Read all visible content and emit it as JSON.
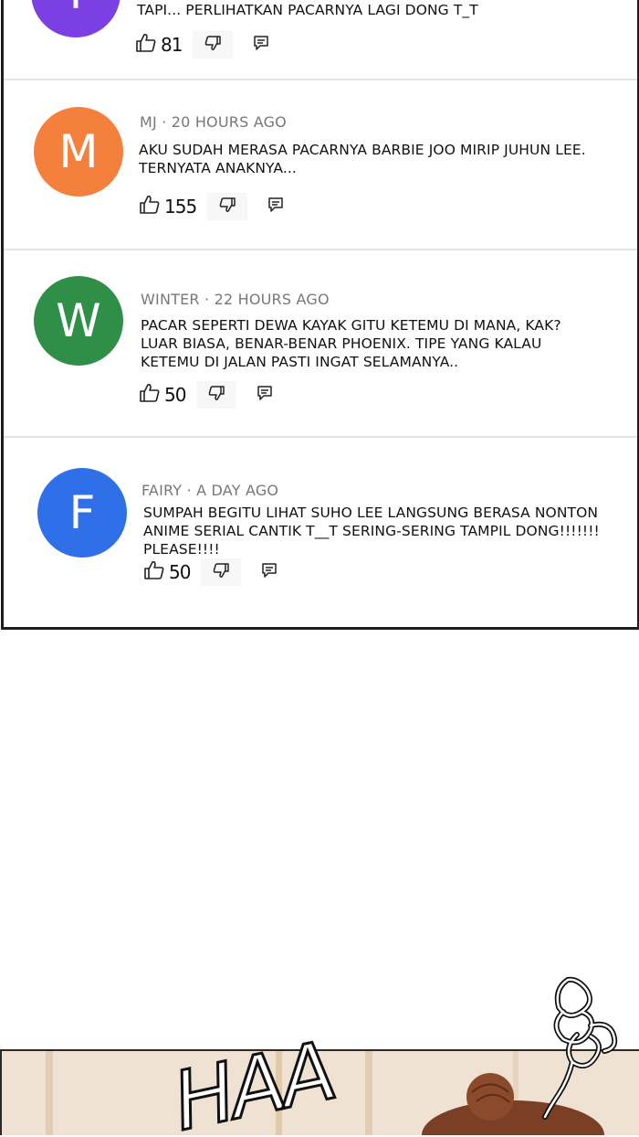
{
  "comments": [
    {
      "avatar_letter": "T",
      "avatar_color": "#7b3fe4",
      "meta": "",
      "text": "TAPI... PERLIHATKAN PACARNYA LAGI DONG T_T",
      "likes": "81"
    },
    {
      "avatar_letter": "M",
      "avatar_color": "#f5803e",
      "meta": "MJ · 20 HOURS AGO",
      "text": "AKU SUDAH MERASA PACARNYA BARBIE JOO MIRIP JUHUN LEE.\nTERNYATA ANAKNYA...",
      "likes": "155"
    },
    {
      "avatar_letter": "W",
      "avatar_color": "#2f8f46",
      "meta": "WINTER · 22 HOURS AGO",
      "text": "PACAR SEPERTI DEWA KAYAK GITU KETEMU DI MANA, KAK?\nLUAR BIASA, BENAR-BENAR PHOENIX. TIPE YANG KALAU\nKETEMU DI JALAN PASTI INGAT SELAMANYA..",
      "likes": "50"
    },
    {
      "avatar_letter": "F",
      "avatar_color": "#2f6fe8",
      "meta": "FAIRY · A DAY AGO",
      "text": "SUMPAH BEGITU LIHAT SUHO LEE LANGSUNG BERASA NONTON\nANIME SERIAL CANTIK T__T SERING-SERING TAMPIL DONG!!!!!!!\nPLEASE!!!!",
      "likes": "50"
    }
  ],
  "sfx_text": "HAA",
  "icons": {
    "like": "thumbs-up-icon",
    "dislike": "thumbs-down-icon",
    "reply": "reply-icon"
  }
}
